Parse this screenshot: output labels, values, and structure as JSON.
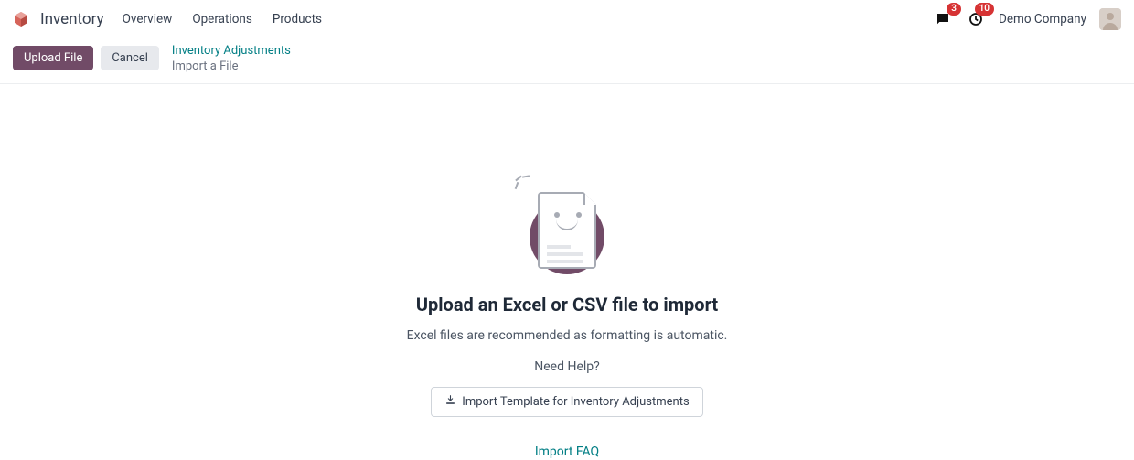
{
  "nav": {
    "app_title": "Inventory",
    "menu": [
      "Overview",
      "Operations",
      "Products"
    ],
    "messages_badge": "3",
    "activities_badge": "10",
    "company": "Demo Company"
  },
  "controls": {
    "upload_label": "Upload File",
    "cancel_label": "Cancel"
  },
  "breadcrumb": {
    "parent": "Inventory Adjustments",
    "current": "Import a File"
  },
  "main": {
    "headline": "Upload an Excel or CSV file to import",
    "subtext": "Excel files are recommended as formatting is automatic.",
    "help_label": "Need Help?",
    "template_button": "Import Template for Inventory Adjustments",
    "faq_link": "Import FAQ"
  },
  "colors": {
    "primary": "#714b67",
    "link": "#017e84",
    "danger": "#d63334"
  }
}
